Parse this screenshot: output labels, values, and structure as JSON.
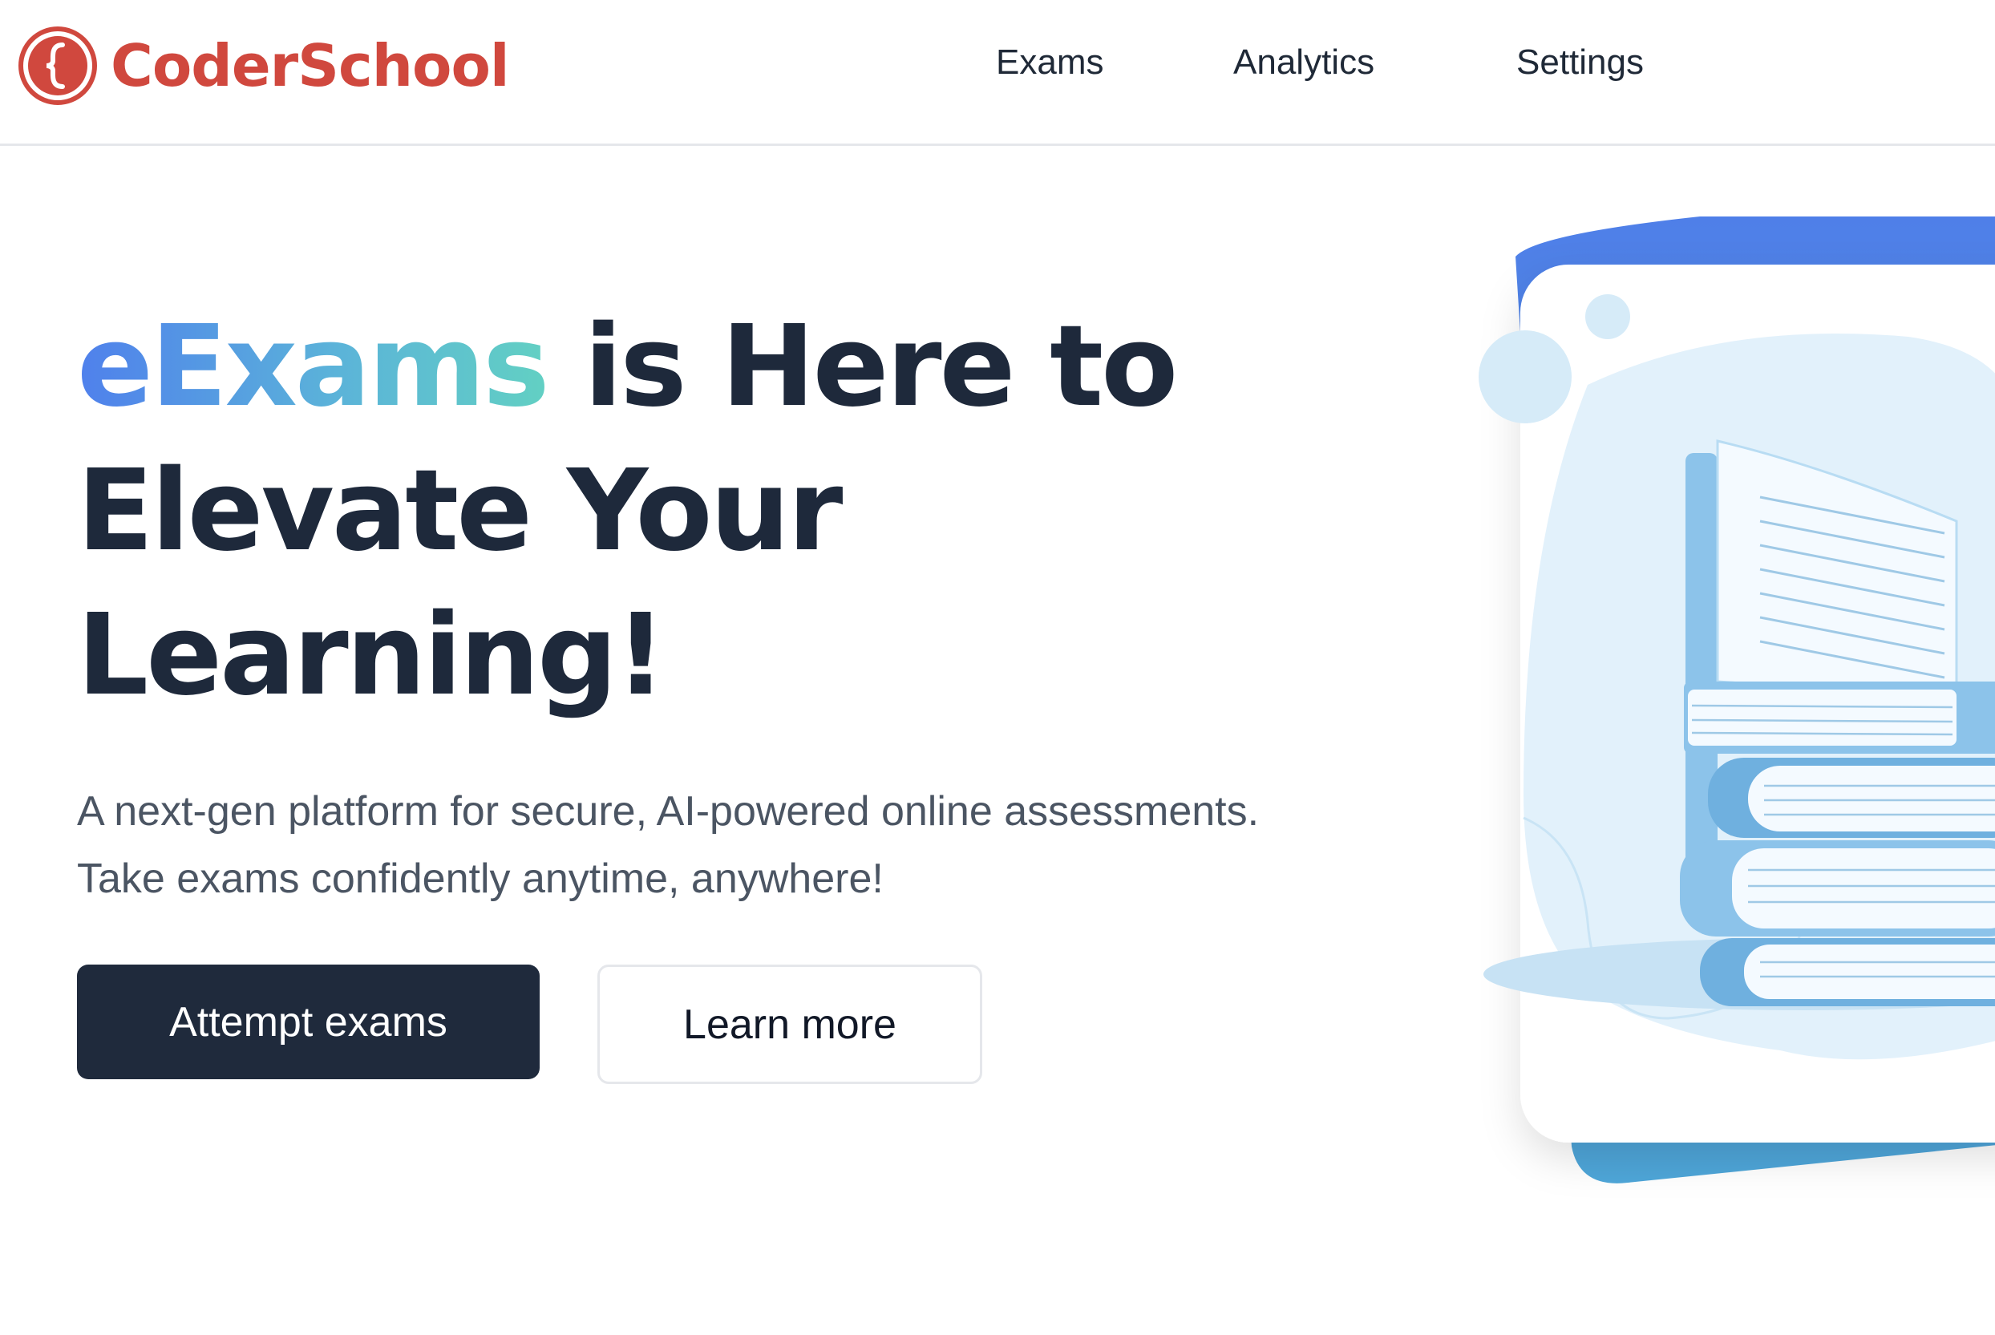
{
  "brand": {
    "name": "CoderSchool",
    "color": "#d0483e"
  },
  "nav": {
    "items": [
      {
        "label": "Exams"
      },
      {
        "label": "Analytics"
      },
      {
        "label": "Settings"
      }
    ]
  },
  "hero": {
    "title_highlight": "eExams",
    "title_rest": " is Here to Elevate Your Learning!",
    "subtitle": "A next-gen platform for secure, AI-powered online assessments. Take exams confidently anytime, anywhere!",
    "primary_button": "Attempt exams",
    "secondary_button": "Learn more"
  },
  "colors": {
    "dark": "#1f2a3c",
    "gradient_start": "#4f80ec",
    "gradient_end": "#62d0c3",
    "illustration_blue": "#8ec5ea"
  },
  "icons": {
    "logo": "brace-circle-logo",
    "illustration": "book-stack-illustration"
  }
}
